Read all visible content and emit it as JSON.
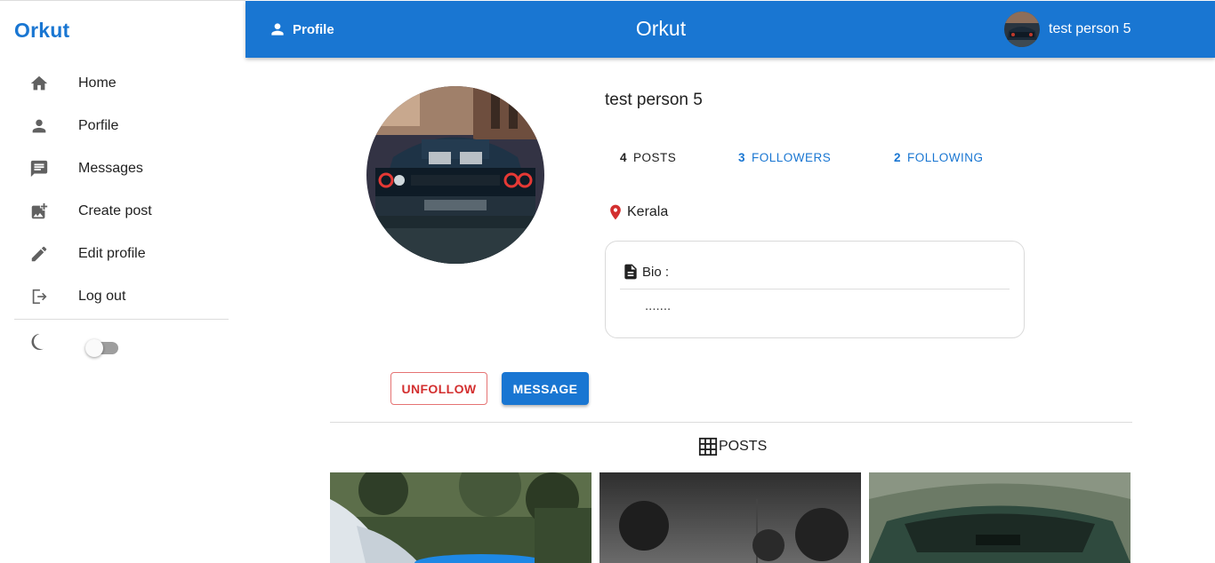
{
  "sidebar": {
    "brand": "Orkut",
    "items": [
      {
        "label": "Home",
        "icon": "home-icon"
      },
      {
        "label": "Porfile",
        "icon": "person-icon"
      },
      {
        "label": "Messages",
        "icon": "message-icon"
      },
      {
        "label": "Create post",
        "icon": "add-photo-icon"
      },
      {
        "label": "Edit profile",
        "icon": "edit-icon"
      },
      {
        "label": "Log out",
        "icon": "logout-icon"
      }
    ],
    "dark_mode_on": false
  },
  "appbar": {
    "section_label": "Profile",
    "title": "Orkut",
    "username": "test person 5"
  },
  "profile": {
    "name": "test person 5",
    "posts_count": "4",
    "posts_label": "POSTS",
    "followers_count": "3",
    "followers_label": "FOLLOWERS",
    "following_count": "2",
    "following_label": "FOLLOWING",
    "location": "Kerala",
    "bio_label": "Bio :",
    "bio_text": "......."
  },
  "actions": {
    "unfollow_label": "UNFOLLOW",
    "message_label": "MESSAGE"
  },
  "posts_section": {
    "label": "POSTS"
  },
  "colors": {
    "primary": "#1976d2",
    "danger": "#d32f2f"
  }
}
